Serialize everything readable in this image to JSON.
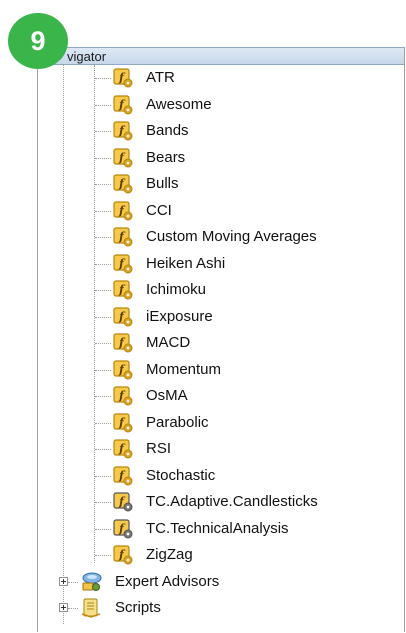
{
  "badge": {
    "step": "9"
  },
  "window": {
    "title": "Navigator",
    "title_visible": "vigator"
  },
  "indicators": [
    {
      "label": "ATR",
      "icon": "custom-indicator-icon"
    },
    {
      "label": "Awesome",
      "icon": "custom-indicator-icon"
    },
    {
      "label": "Bands",
      "icon": "custom-indicator-icon"
    },
    {
      "label": "Bears",
      "icon": "custom-indicator-icon"
    },
    {
      "label": "Bulls",
      "icon": "custom-indicator-icon"
    },
    {
      "label": "CCI",
      "icon": "custom-indicator-icon"
    },
    {
      "label": "Custom Moving Averages",
      "icon": "custom-indicator-icon"
    },
    {
      "label": "Heiken Ashi",
      "icon": "custom-indicator-icon"
    },
    {
      "label": "Ichimoku",
      "icon": "custom-indicator-icon"
    },
    {
      "label": "iExposure",
      "icon": "custom-indicator-icon"
    },
    {
      "label": "MACD",
      "icon": "custom-indicator-icon"
    },
    {
      "label": "Momentum",
      "icon": "custom-indicator-icon"
    },
    {
      "label": "OsMA",
      "icon": "custom-indicator-icon"
    },
    {
      "label": "Parabolic",
      "icon": "custom-indicator-icon"
    },
    {
      "label": "RSI",
      "icon": "custom-indicator-icon"
    },
    {
      "label": "Stochastic",
      "icon": "custom-indicator-icon"
    },
    {
      "label": "TC.Adaptive.Candlesticks",
      "icon": "custom-indicator-gray-icon"
    },
    {
      "label": "TC.TechnicalAnalysis",
      "icon": "custom-indicator-gray-icon"
    },
    {
      "label": "ZigZag",
      "icon": "custom-indicator-icon"
    }
  ],
  "folders": [
    {
      "label": "Expert Advisors",
      "icon": "expert-advisors-icon",
      "expanded": false
    },
    {
      "label": "Scripts",
      "icon": "scripts-icon",
      "expanded": false
    }
  ],
  "colors": {
    "badge": "#3ab54a",
    "icon_fill": "#f6c94a",
    "icon_border": "#b8860b",
    "icon_gray_border": "#555555",
    "title_bar": "#c7d7ea"
  }
}
